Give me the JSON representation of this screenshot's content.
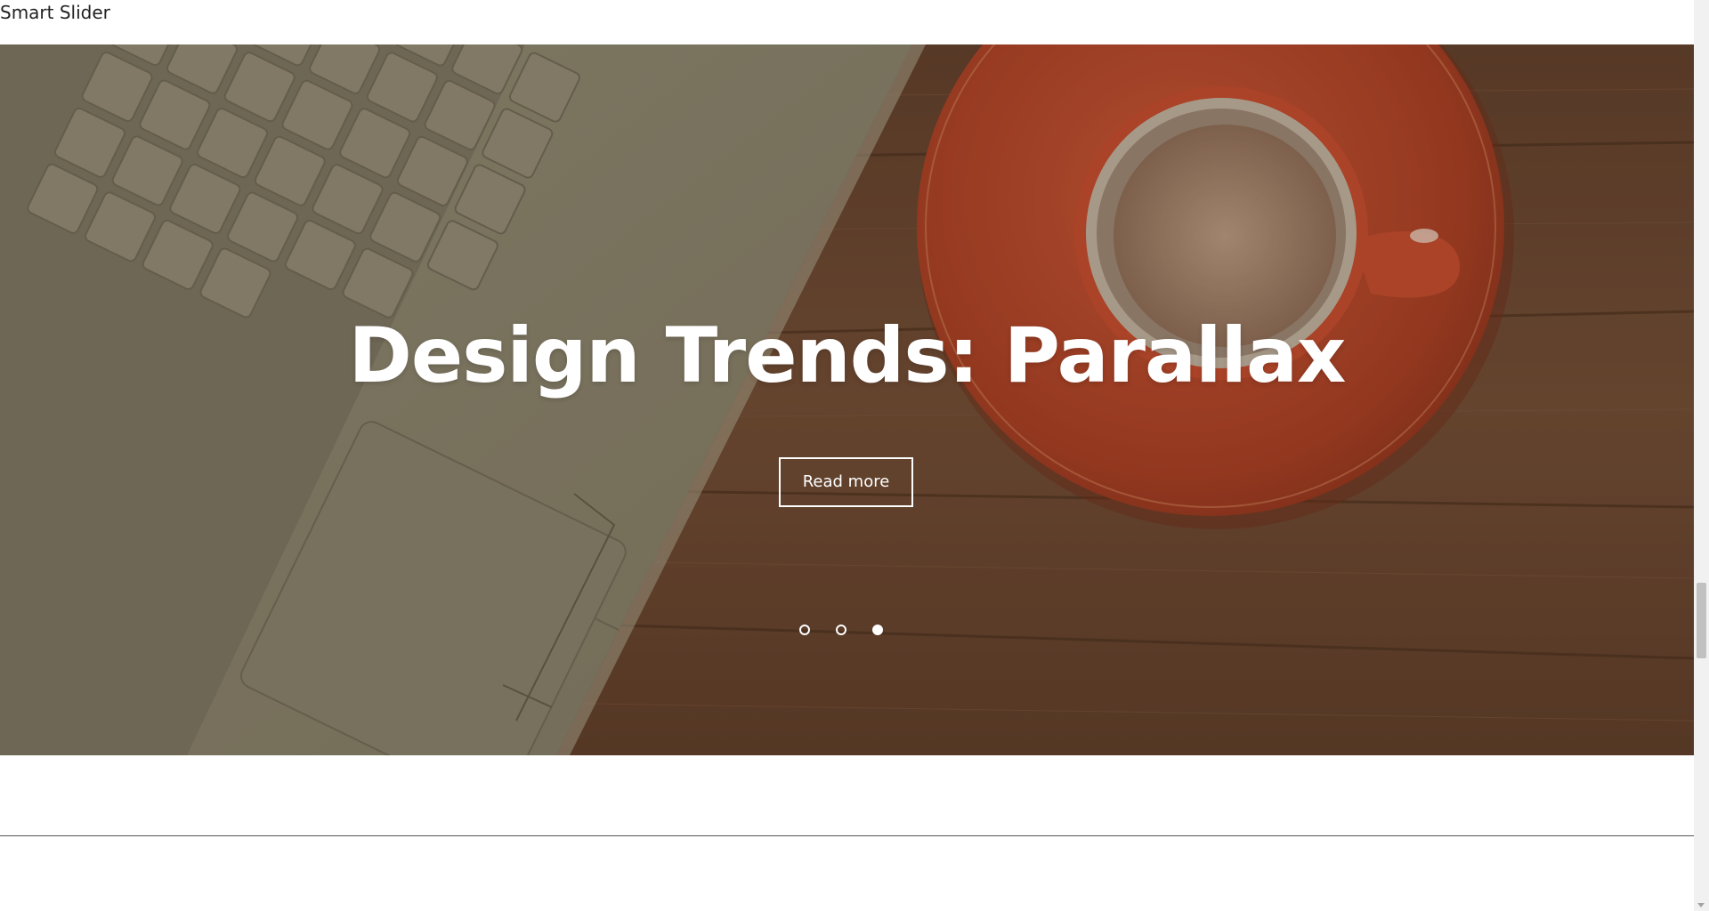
{
  "section": {
    "title": "Smart Slider"
  },
  "slider": {
    "heading": "Design Trends: Parallax",
    "button_label": "Read more",
    "slides_total": 3,
    "active_slide": 3
  },
  "colors": {
    "wood": "#6b4a35",
    "saucer": "#b8492c",
    "laptop": "#8a8670",
    "text": "#ffffff"
  }
}
